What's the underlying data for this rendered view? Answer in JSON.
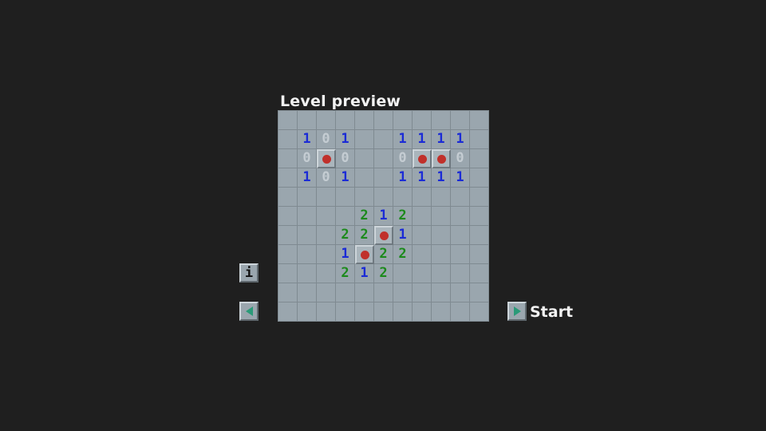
{
  "title": "Level preview",
  "start_label": "Start",
  "info_label": "i",
  "icons": {
    "info": "info-icon",
    "prev": "arrow-left-icon",
    "next": "arrow-right-icon",
    "mine": "mine-icon"
  },
  "colors": {
    "background": "#1f1f1f",
    "cell": "#9aa6ae",
    "number_1": "#1b2bd6",
    "number_2": "#1c8a1c",
    "number_0": "#c4ccd2",
    "mine": "#c0302b",
    "arrow": "#2a9a78"
  },
  "board": {
    "rows": 11,
    "cols": 11,
    "grid": [
      [
        ".",
        ".",
        ".",
        ".",
        ".",
        ".",
        ".",
        ".",
        ".",
        ".",
        "."
      ],
      [
        ".",
        "1",
        "0",
        "1",
        ".",
        ".",
        "1",
        "1",
        "1",
        "1",
        "."
      ],
      [
        ".",
        "0",
        "*",
        "0",
        ".",
        ".",
        "0",
        "*",
        "*",
        "0",
        "."
      ],
      [
        ".",
        "1",
        "0",
        "1",
        ".",
        ".",
        "1",
        "1",
        "1",
        "1",
        "."
      ],
      [
        ".",
        ".",
        ".",
        ".",
        ".",
        ".",
        ".",
        ".",
        ".",
        ".",
        "."
      ],
      [
        ".",
        ".",
        ".",
        ".",
        "2",
        "1",
        "2",
        ".",
        ".",
        ".",
        "."
      ],
      [
        ".",
        ".",
        ".",
        "2",
        "2",
        "*",
        "1",
        ".",
        ".",
        ".",
        "."
      ],
      [
        ".",
        ".",
        ".",
        "1",
        "*",
        "2",
        "2",
        ".",
        ".",
        ".",
        "."
      ],
      [
        ".",
        ".",
        ".",
        "2",
        "1",
        "2",
        ".",
        ".",
        ".",
        ".",
        "."
      ],
      [
        ".",
        ".",
        ".",
        ".",
        ".",
        ".",
        ".",
        ".",
        ".",
        ".",
        "."
      ],
      [
        ".",
        ".",
        ".",
        ".",
        ".",
        ".",
        ".",
        ".",
        ".",
        ".",
        "."
      ]
    ]
  }
}
